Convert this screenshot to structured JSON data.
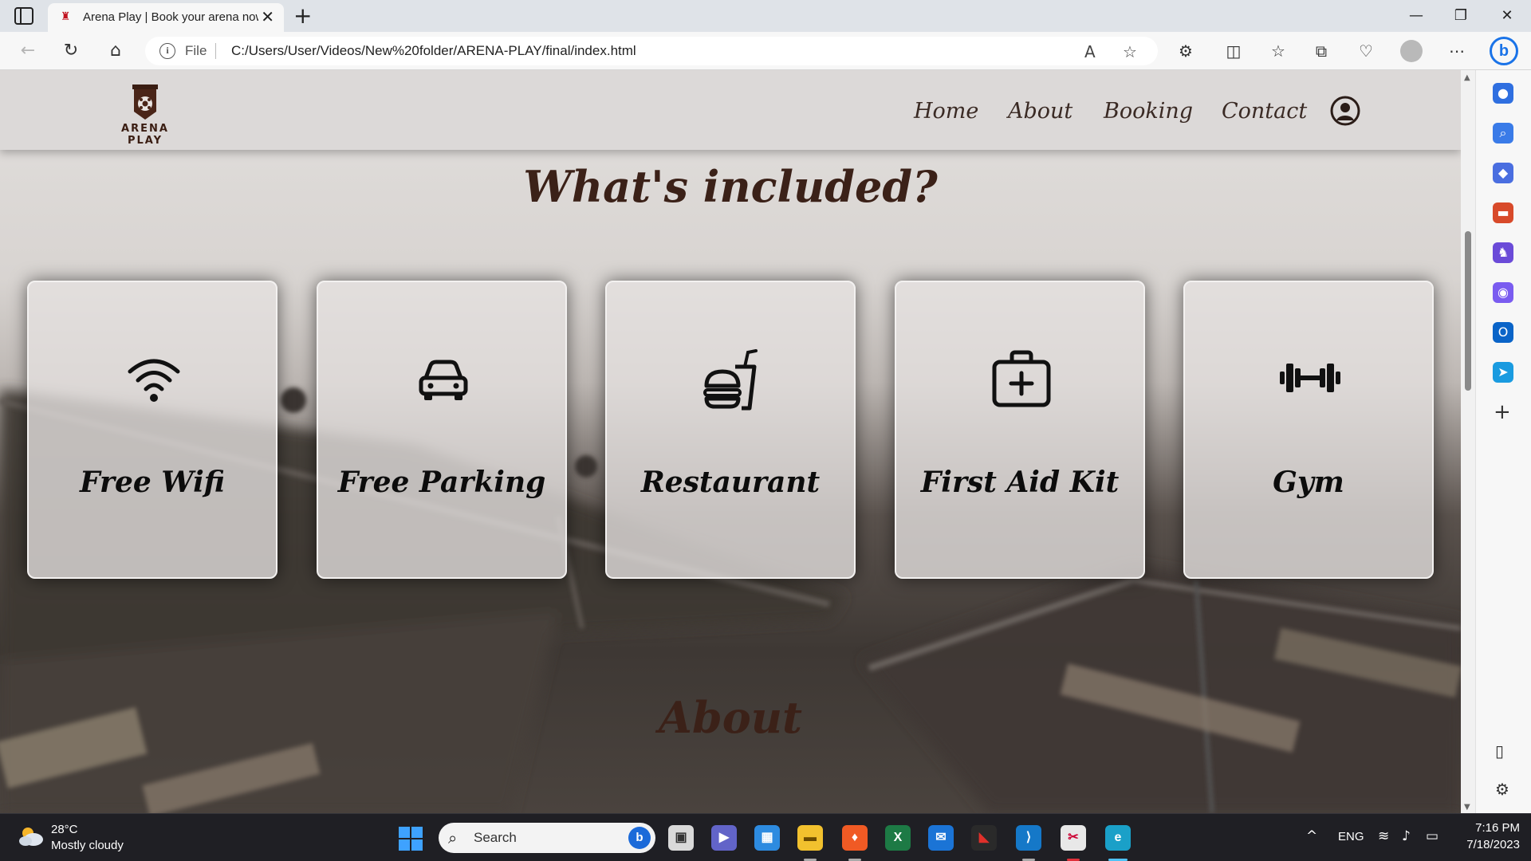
{
  "browser": {
    "tab_title": "Arena Play | Book your arena now",
    "tab_close": "✕",
    "new_tab": "+",
    "url_scheme_label": "File",
    "url": "C:/Users/User/Videos/New%20folder/ARENA-PLAY/final/index.html",
    "window_minimize": "—",
    "window_restore": "❐",
    "window_close": "✕"
  },
  "site": {
    "logo_text": "ARENA PLAY",
    "nav": [
      "Home",
      "About",
      "Booking",
      "Contact"
    ],
    "included_title": "What's included?",
    "features": [
      {
        "label": "Free Wifi",
        "icon": "wifi-icon"
      },
      {
        "label": "Free Parking",
        "icon": "car-icon"
      },
      {
        "label": "Restaurant",
        "icon": "food-icon"
      },
      {
        "label": "First Aid Kit",
        "icon": "first-aid-icon"
      },
      {
        "label": "Gym",
        "icon": "dumbbell-icon"
      }
    ],
    "about_title": "About"
  },
  "taskbar": {
    "weather_temp": "28°C",
    "weather_desc": "Mostly cloudy",
    "search_placeholder": "Search",
    "language": "ENG",
    "time": "7:16 PM",
    "date": "7/18/2023"
  },
  "colors": {
    "heading": "#3b2118",
    "nav_text": "#3a2a24",
    "card_text": "#0c0c0c",
    "header_bg": "#dcd9d8",
    "accent_blue": "#1a73e8"
  }
}
